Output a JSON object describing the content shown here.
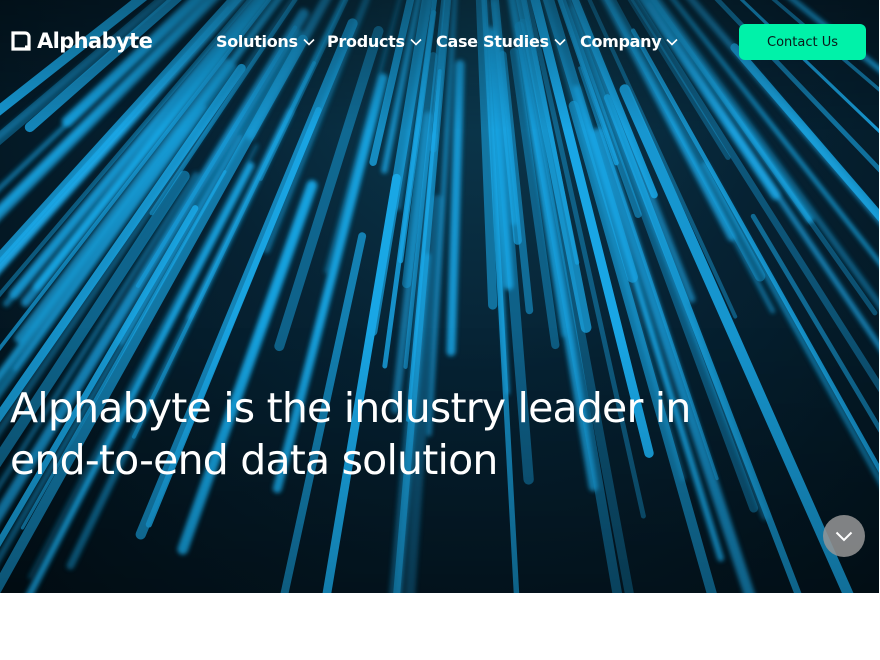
{
  "brand": {
    "name": "Alphabyte",
    "logo_icon": "alphabyte-logo-mark"
  },
  "nav": {
    "items": [
      {
        "label": "Solutions",
        "icon": "chevron-down-icon"
      },
      {
        "label": "Products",
        "icon": "chevron-down-icon"
      },
      {
        "label": "Case Studies",
        "icon": "chevron-down-icon"
      },
      {
        "label": "Company",
        "icon": "chevron-down-icon"
      }
    ],
    "cta_label": "Contact Us"
  },
  "hero": {
    "headline_line1": "Alphabyte is the industry leader in",
    "headline_line2": "end-to-end data solution",
    "scroll_icon": "chevron-down-icon"
  },
  "colors": {
    "accent": "#00f2a9",
    "ray_blue": "#1aa7e6",
    "hero_dark": "#031520",
    "text": "#ffffff"
  }
}
